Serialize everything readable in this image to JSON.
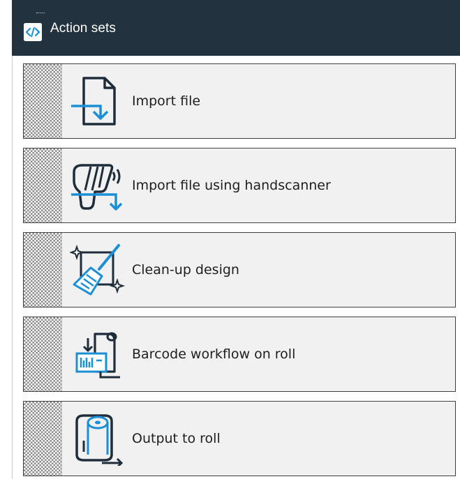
{
  "header": {
    "title": "Action sets",
    "icon": "code-icon"
  },
  "action_sets": [
    {
      "label": "Import file",
      "icon": "import-file-icon"
    },
    {
      "label": "Import file using handscanner",
      "icon": "handscanner-icon"
    },
    {
      "label": "Clean-up design",
      "icon": "clean-up-broom-icon"
    },
    {
      "label": "Barcode workflow on roll",
      "icon": "barcode-roll-icon"
    },
    {
      "label": "Output to roll",
      "icon": "output-roll-icon"
    }
  ],
  "colors": {
    "header_bg": "#22333f",
    "accent_blue": "#1b8fd6",
    "icon_dark": "#1f2d3a",
    "card_bg": "#f1f1f1"
  }
}
